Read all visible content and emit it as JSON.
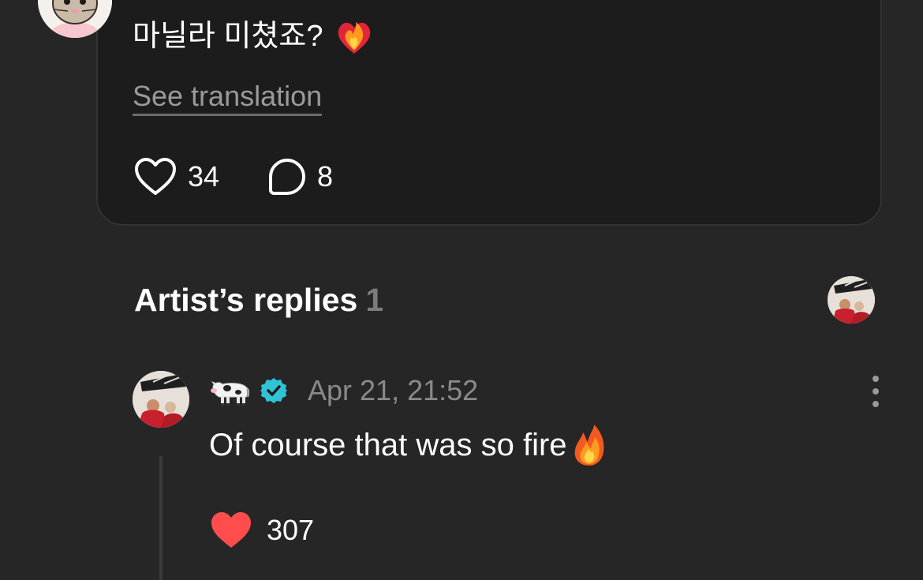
{
  "post": {
    "text": "마닐라 미쳤죠?",
    "text_emoji": "heart-on-fire",
    "see_translation": "See translation",
    "like_count": "34",
    "comment_count": "8",
    "avatar": "bunny-avatar"
  },
  "artist_replies": {
    "title": "Artist’s replies",
    "count": "1"
  },
  "reply": {
    "username_emoji": "cow",
    "verified": true,
    "timestamp": "Apr 21, 21:52",
    "text": "Of course that was so fire",
    "text_emoji": "fire",
    "like_count": "307"
  },
  "colors": {
    "background": "#262626",
    "card": "#1c1c1c",
    "verified": "#2ec4d6",
    "liked_heart": "#ff4d4d",
    "muted_text": "#8a8a8a"
  }
}
